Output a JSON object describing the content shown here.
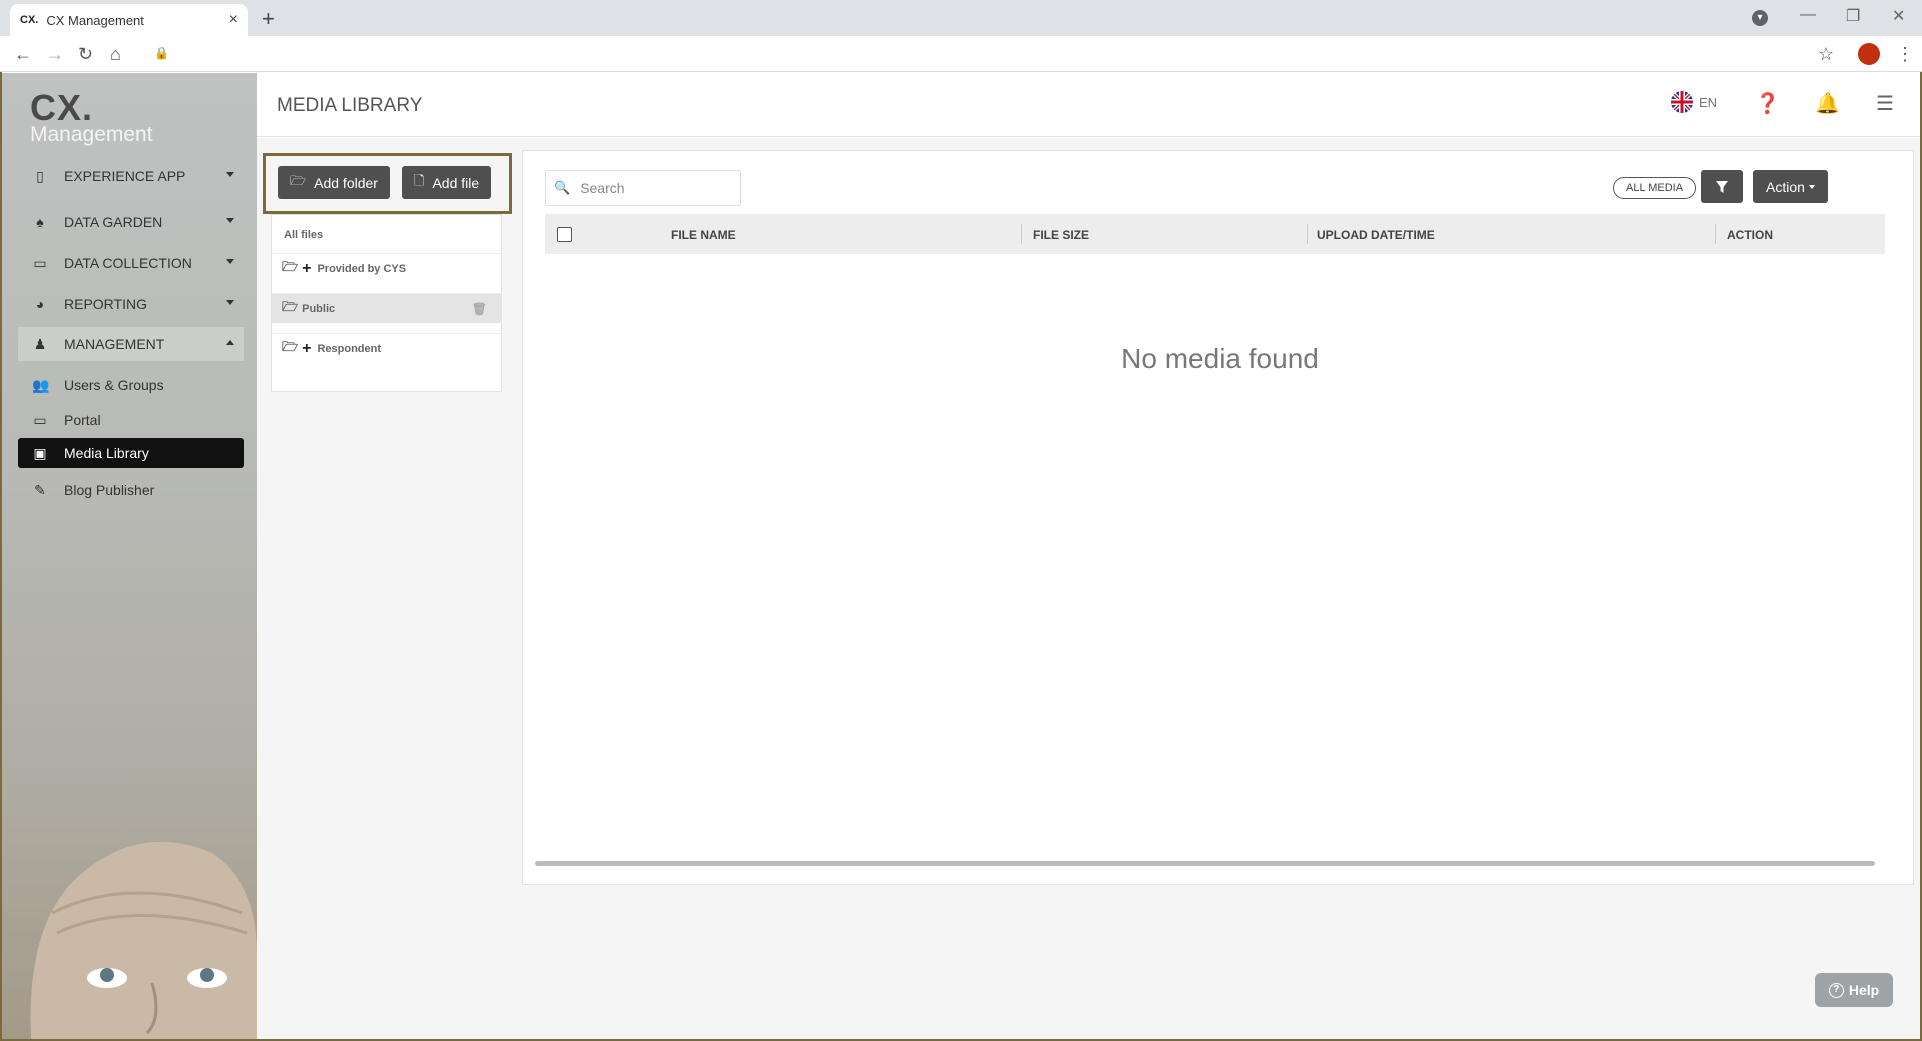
{
  "browser": {
    "tab_title": "CX Management",
    "tab_favicon": "CX.",
    "tab_close": "×",
    "new_tab": "+"
  },
  "sidebar": {
    "logo_main": "CX.",
    "logo_sub": "Management",
    "items": [
      {
        "label": "EXPERIENCE APP",
        "icon": "phone-icon",
        "state": "collapsed"
      },
      {
        "label": "DATA GARDEN",
        "icon": "tree-icon",
        "state": "collapsed"
      },
      {
        "label": "DATA COLLECTION",
        "icon": "inbox-icon",
        "state": "collapsed"
      },
      {
        "label": "REPORTING",
        "icon": "pie-chart-icon",
        "state": "collapsed"
      },
      {
        "label": "MANAGEMENT",
        "icon": "user-tie-icon",
        "state": "expanded"
      }
    ],
    "subitems": [
      {
        "label": "Users & Groups",
        "icon": "users-icon"
      },
      {
        "label": "Portal",
        "icon": "monitor-icon"
      },
      {
        "label": "Media Library",
        "icon": "images-icon",
        "active": true
      },
      {
        "label": "Blog Publisher",
        "icon": "pencil-icon"
      }
    ]
  },
  "header": {
    "title": "MEDIA LIBRARY",
    "language": "EN"
  },
  "toolbar": {
    "add_folder": "Add folder",
    "add_file": "Add file"
  },
  "folders": {
    "heading": "All files",
    "items": [
      {
        "label": "Provided by CYS",
        "expandable": true
      },
      {
        "label": "Public",
        "expandable": false,
        "selected": true
      },
      {
        "label": "Respondent",
        "expandable": true
      }
    ]
  },
  "media": {
    "search_placeholder": "Search",
    "all_media": "ALL MEDIA",
    "action": "Action",
    "columns": [
      "FILE NAME",
      "FILE SIZE",
      "UPLOAD DATE/TIME",
      "ACTION"
    ],
    "empty_message": "No media found"
  },
  "help": {
    "label": "Help"
  },
  "colors": {
    "dark_button": "#4f4f4f",
    "highlight_border": "#7a6a3c",
    "active_nav": "#111111"
  }
}
